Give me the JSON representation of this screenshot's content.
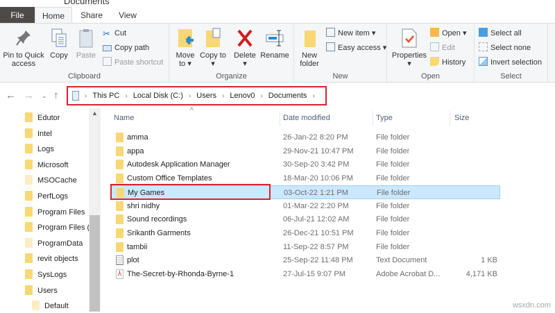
{
  "window": {
    "title": "Documents"
  },
  "tabs": [
    "File",
    "Home",
    "Share",
    "View"
  ],
  "ribbon": {
    "clipboard": {
      "label": "Clipboard",
      "pin": "Pin to Quick access",
      "copy": "Copy",
      "paste": "Paste",
      "cut": "Cut",
      "copy_path": "Copy path",
      "paste_shortcut": "Paste shortcut"
    },
    "organize": {
      "label": "Organize",
      "move_to": "Move to",
      "copy_to": "Copy to",
      "delete": "Delete",
      "rename": "Rename"
    },
    "new": {
      "label": "New",
      "new_folder": "New folder",
      "new_item": "New item",
      "easy_access": "Easy access"
    },
    "open": {
      "label": "Open",
      "properties": "Properties",
      "open": "Open",
      "edit": "Edit",
      "history": "History"
    },
    "select": {
      "label": "Select",
      "select_all": "Select all",
      "select_none": "Select none",
      "invert": "Invert selection"
    }
  },
  "breadcrumb": [
    "This PC",
    "Local Disk (C:)",
    "Users",
    "Lenov0",
    "Documents"
  ],
  "sidebar": [
    {
      "label": "Edutor",
      "pale": false
    },
    {
      "label": "Intel",
      "pale": false
    },
    {
      "label": "Logs",
      "pale": false
    },
    {
      "label": "Microsoft",
      "pale": false
    },
    {
      "label": "MSOCache",
      "pale": true
    },
    {
      "label": "PerfLogs",
      "pale": false
    },
    {
      "label": "Program Files",
      "pale": false
    },
    {
      "label": "Program Files (",
      "pale": false
    },
    {
      "label": "ProgramData",
      "pale": true
    },
    {
      "label": "revit objects",
      "pale": false
    },
    {
      "label": "SysLogs",
      "pale": false
    },
    {
      "label": "Users",
      "pale": false
    },
    {
      "label": "Default",
      "pale": true
    }
  ],
  "columns": {
    "name": "Name",
    "date": "Date modified",
    "type": "Type",
    "size": "Size"
  },
  "files": [
    {
      "name": "amma",
      "date": "26-Jan-22 8:20 PM",
      "type": "File folder",
      "size": "",
      "icon": "folder"
    },
    {
      "name": "appa",
      "date": "29-Nov-21 10:47 PM",
      "type": "File folder",
      "size": "",
      "icon": "folder"
    },
    {
      "name": "Autodesk Application Manager",
      "date": "30-Sep-20 3:42 PM",
      "type": "File folder",
      "size": "",
      "icon": "folder"
    },
    {
      "name": "Custom Office Templates",
      "date": "18-Mar-20 10:06 PM",
      "type": "File folder",
      "size": "",
      "icon": "folder"
    },
    {
      "name": "My Games",
      "date": "03-Oct-22 1:21 PM",
      "type": "File folder",
      "size": "",
      "icon": "folder",
      "selected": true
    },
    {
      "name": "shri nidhy",
      "date": "01-Mar-22 2:20 PM",
      "type": "File folder",
      "size": "",
      "icon": "folder"
    },
    {
      "name": "Sound recordings",
      "date": "06-Jul-21 12:02 AM",
      "type": "File folder",
      "size": "",
      "icon": "folder"
    },
    {
      "name": "Srikanth Garments",
      "date": "26-Dec-21 10:51 PM",
      "type": "File folder",
      "size": "",
      "icon": "folder"
    },
    {
      "name": "tambii",
      "date": "11-Sep-22 8:57 PM",
      "type": "File folder",
      "size": "",
      "icon": "folder"
    },
    {
      "name": "plot",
      "date": "25-Sep-22 11:48 PM",
      "type": "Text Document",
      "size": "1 KB",
      "icon": "text"
    },
    {
      "name": "The-Secret-by-Rhonda-Byrne-1",
      "date": "27-Jul-15 9:07 PM",
      "type": "Adobe Acrobat D...",
      "size": "4,171 KB",
      "icon": "pdf"
    }
  ],
  "watermark": "wsxdn.com"
}
